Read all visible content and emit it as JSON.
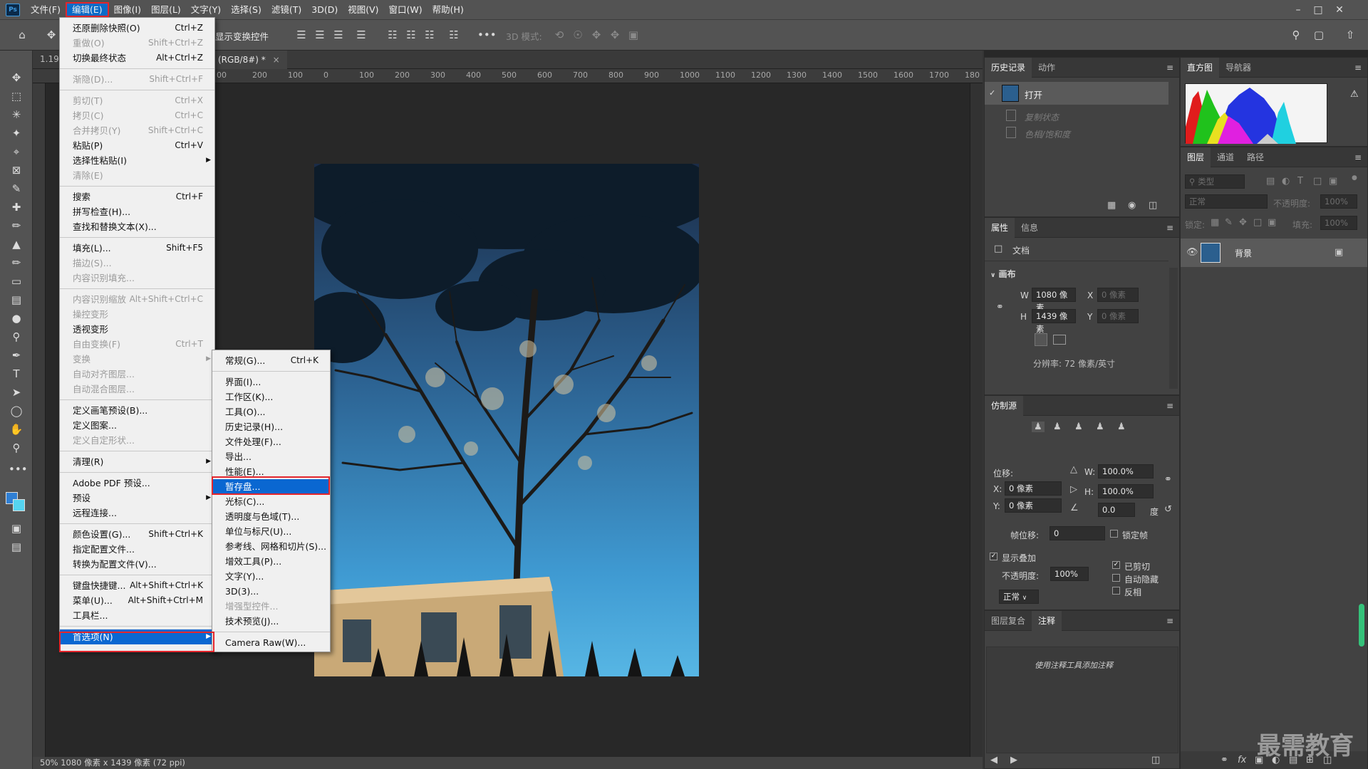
{
  "menubar": {
    "items": [
      "文件(F)",
      "编辑(E)",
      "图像(I)",
      "图层(L)",
      "文字(Y)",
      "选择(S)",
      "滤镜(T)",
      "3D(D)",
      "视图(V)",
      "窗口(W)",
      "帮助(H)"
    ],
    "logo": "Ps"
  },
  "options": {
    "show_transform": "显示变换控件",
    "mode_3d": "3D 模式:"
  },
  "doc": {
    "tab_label": "(RGB/8#) *",
    "zoom_left": "1.19",
    "status": "50%   1080 像素 x 1439 像素 (72 ppi)"
  },
  "ruler_h": [
    "00",
    "200",
    "100",
    "0",
    "100",
    "200",
    "300",
    "400",
    "500",
    "600",
    "700",
    "800",
    "900",
    "1000",
    "1100",
    "1200",
    "1300",
    "1400",
    "1500",
    "1600",
    "1700",
    "180"
  ],
  "edit_menu": [
    {
      "label": "还原删除快照(O)",
      "sc": "Ctrl+Z",
      "dis": false
    },
    {
      "label": "重做(O)",
      "sc": "Shift+Ctrl+Z",
      "dis": true
    },
    {
      "label": "切换最终状态",
      "sc": "Alt+Ctrl+Z",
      "dis": false
    },
    {
      "sep": true
    },
    {
      "label": "渐隐(D)...",
      "sc": "Shift+Ctrl+F",
      "dis": true
    },
    {
      "sep": true
    },
    {
      "label": "剪切(T)",
      "sc": "Ctrl+X",
      "dis": true
    },
    {
      "label": "拷贝(C)",
      "sc": "Ctrl+C",
      "dis": true
    },
    {
      "label": "合并拷贝(Y)",
      "sc": "Shift+Ctrl+C",
      "dis": true
    },
    {
      "label": "粘贴(P)",
      "sc": "Ctrl+V",
      "dis": false
    },
    {
      "label": "选择性粘贴(I)",
      "sc": "",
      "dis": false,
      "sub": true
    },
    {
      "label": "清除(E)",
      "sc": "",
      "dis": true
    },
    {
      "sep": true
    },
    {
      "label": "搜索",
      "sc": "Ctrl+F",
      "dis": false
    },
    {
      "label": "拼写检查(H)...",
      "sc": "",
      "dis": false
    },
    {
      "label": "查找和替换文本(X)...",
      "sc": "",
      "dis": false
    },
    {
      "sep": true
    },
    {
      "label": "填充(L)...",
      "sc": "Shift+F5",
      "dis": false
    },
    {
      "label": "描边(S)...",
      "sc": "",
      "dis": true
    },
    {
      "label": "内容识别填充...",
      "sc": "",
      "dis": true
    },
    {
      "sep": true
    },
    {
      "label": "内容识别缩放",
      "sc": "Alt+Shift+Ctrl+C",
      "dis": true
    },
    {
      "label": "操控变形",
      "sc": "",
      "dis": true
    },
    {
      "label": "透视变形",
      "sc": "",
      "dis": false
    },
    {
      "label": "自由变换(F)",
      "sc": "Ctrl+T",
      "dis": true
    },
    {
      "label": "变换",
      "sc": "",
      "dis": true,
      "sub": true
    },
    {
      "label": "自动对齐图层...",
      "sc": "",
      "dis": true
    },
    {
      "label": "自动混合图层...",
      "sc": "",
      "dis": true
    },
    {
      "sep": true
    },
    {
      "label": "定义画笔预设(B)...",
      "sc": "",
      "dis": false
    },
    {
      "label": "定义图案...",
      "sc": "",
      "dis": false
    },
    {
      "label": "定义自定形状...",
      "sc": "",
      "dis": true
    },
    {
      "sep": true
    },
    {
      "label": "清理(R)",
      "sc": "",
      "dis": false,
      "sub": true
    },
    {
      "sep": true
    },
    {
      "label": "Adobe PDF 预设...",
      "sc": "",
      "dis": false
    },
    {
      "label": "预设",
      "sc": "",
      "dis": false,
      "sub": true
    },
    {
      "label": "远程连接...",
      "sc": "",
      "dis": false
    },
    {
      "sep": true
    },
    {
      "label": "颜色设置(G)...",
      "sc": "Shift+Ctrl+K",
      "dis": false
    },
    {
      "label": "指定配置文件...",
      "sc": "",
      "dis": false
    },
    {
      "label": "转换为配置文件(V)...",
      "sc": "",
      "dis": false
    },
    {
      "sep": true
    },
    {
      "label": "键盘快捷键...",
      "sc": "Alt+Shift+Ctrl+K",
      "dis": false
    },
    {
      "label": "菜单(U)...",
      "sc": "Alt+Shift+Ctrl+M",
      "dis": false
    },
    {
      "label": "工具栏...",
      "sc": "",
      "dis": false
    },
    {
      "sep": true
    },
    {
      "label": "首选项(N)",
      "sc": "",
      "dis": false,
      "sub": true,
      "hl": true
    }
  ],
  "prefs_menu": [
    {
      "label": "常规(G)...",
      "sc": "Ctrl+K",
      "dis": false
    },
    {
      "sep": true
    },
    {
      "label": "界面(I)...",
      "sc": "",
      "dis": false
    },
    {
      "label": "工作区(K)...",
      "sc": "",
      "dis": false
    },
    {
      "label": "工具(O)...",
      "sc": "",
      "dis": false
    },
    {
      "label": "历史记录(H)...",
      "sc": "",
      "dis": false
    },
    {
      "label": "文件处理(F)...",
      "sc": "",
      "dis": false
    },
    {
      "label": "导出...",
      "sc": "",
      "dis": false
    },
    {
      "label": "性能(E)...",
      "sc": "",
      "dis": false
    },
    {
      "label": "暂存盘...",
      "sc": "",
      "dis": false,
      "hl": true
    },
    {
      "label": "光标(C)...",
      "sc": "",
      "dis": false
    },
    {
      "label": "透明度与色域(T)...",
      "sc": "",
      "dis": false
    },
    {
      "label": "单位与标尺(U)...",
      "sc": "",
      "dis": false
    },
    {
      "label": "参考线、网格和切片(S)...",
      "sc": "",
      "dis": false
    },
    {
      "label": "增效工具(P)...",
      "sc": "",
      "dis": false
    },
    {
      "label": "文字(Y)...",
      "sc": "",
      "dis": false
    },
    {
      "label": "3D(3)...",
      "sc": "",
      "dis": false
    },
    {
      "label": "增强型控件...",
      "sc": "",
      "dis": true
    },
    {
      "label": "技术预览(J)...",
      "sc": "",
      "dis": false
    },
    {
      "sep": true
    },
    {
      "label": "Camera Raw(W)...",
      "sc": "",
      "dis": false
    }
  ],
  "history": {
    "tabs": [
      "历史记录",
      "动作"
    ],
    "items": [
      "打开",
      "复制状态",
      "色相/饱和度"
    ]
  },
  "properties": {
    "tabs": [
      "属性",
      "信息"
    ],
    "doc_label": "文档",
    "canvas_label": "画布",
    "w_label": "W",
    "w_val": "1080 像素",
    "h_label": "H",
    "h_val": "1439 像素",
    "x_label": "X",
    "x_val": "0 像素",
    "y_label": "Y",
    "y_val": "0 像素",
    "resolution": "分辨率: 72 像素/英寸"
  },
  "clone": {
    "title": "仿制源",
    "offset": "位移:",
    "x_label": "X:",
    "x_val": "0 像素",
    "y_label": "Y:",
    "y_val": "0 像素",
    "w_label": "W:",
    "w_val": "100.0%",
    "h_label": "H:",
    "h_val": "100.0%",
    "angle": "0.0",
    "deg": "度",
    "frame_offset": "帧位移:",
    "frame_val": "0",
    "lock_frame": "锁定帧",
    "show_overlay": "显示叠加",
    "opacity_label": "不透明度:",
    "opacity_val": "100%",
    "clipped": "已剪切",
    "auto_hide": "自动隐藏",
    "invert": "反相",
    "blend": "正常"
  },
  "notes": {
    "tabs": [
      "图层复合",
      "注释"
    ],
    "hint": "使用注释工具添加注释"
  },
  "histogram": {
    "tabs": [
      "直方图",
      "导航器"
    ]
  },
  "layers": {
    "tabs": [
      "图层",
      "通道",
      "路径"
    ],
    "search": "类型",
    "blend": "正常",
    "opacity_label": "不透明度:",
    "opacity_val": "100%",
    "lock_label": "锁定:",
    "fill_label": "填充:",
    "fill_val": "100%",
    "layer_name": "背景"
  },
  "watermark": "最需教育"
}
